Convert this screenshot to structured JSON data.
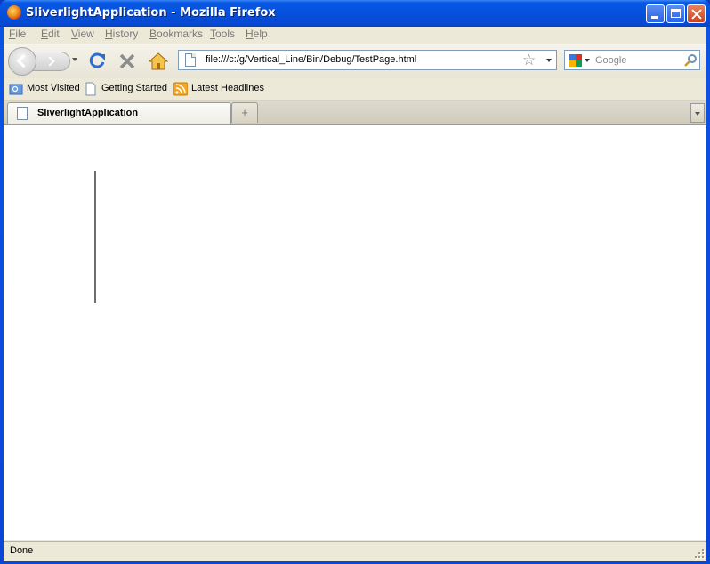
{
  "window": {
    "title": "SliverlightApplication - Mozilla Firefox"
  },
  "menu": [
    "File",
    "Edit",
    "View",
    "History",
    "Bookmarks",
    "Tools",
    "Help"
  ],
  "menu_mnemonics": [
    "F",
    "E",
    "V",
    "H",
    "B",
    "T",
    "H"
  ],
  "navbar": {
    "url": "file:///c:/g/Vertical_Line/Bin/Debug/TestPage.html",
    "search_placeholder": "Google"
  },
  "bookmarks": [
    "Most Visited",
    "Getting Started",
    "Latest Headlines"
  ],
  "tabs": [
    {
      "label": "SliverlightApplication",
      "active": true
    }
  ],
  "newtab_symbol": "+",
  "status": {
    "text": "Done"
  },
  "colors": {
    "titlebar": "#0550dc",
    "content_background": "#ffffff",
    "line": "#6e6e6e"
  }
}
